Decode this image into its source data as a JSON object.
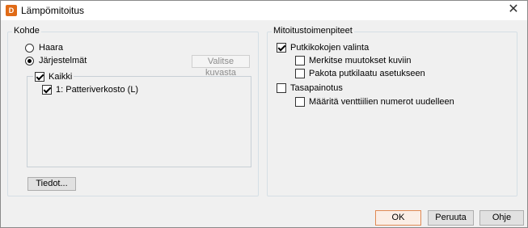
{
  "window": {
    "app_icon_letter": "D",
    "title": "Lämpömitoitus",
    "close_glyph": "✕"
  },
  "kohde": {
    "label": "Kohde",
    "radio_haara": {
      "label": "Haara",
      "checked": false
    },
    "radio_jarjestelmat": {
      "label": "Järjestelmät",
      "checked": true
    },
    "select_from_image_button": "Valitse kuvasta",
    "tree": {
      "all": {
        "label": "Kaikki",
        "checked": true
      },
      "items": [
        {
          "label": "1: Patteriverkosto (L)",
          "checked": true
        }
      ]
    },
    "details_button": "Tiedot..."
  },
  "mitoitus": {
    "label": "Mitoitustoimenpiteet",
    "pipe_size": {
      "label": "Putkikokojen valinta",
      "checked": true
    },
    "mark_changes": {
      "label": "Merkitse muutokset kuviin",
      "checked": false
    },
    "force_quality": {
      "label": "Pakota putkilaatu asetukseen",
      "checked": false
    },
    "balancing": {
      "label": "Tasapainotus",
      "checked": false
    },
    "renumber_valves": {
      "label": "Määritä venttiilien numerot uudelleen",
      "checked": false
    }
  },
  "footer": {
    "ok": "OK",
    "cancel": "Peruuta",
    "help": "Ohje"
  },
  "colors": {
    "app_icon": "#e06b17",
    "default_button_border": "#e08a55"
  }
}
